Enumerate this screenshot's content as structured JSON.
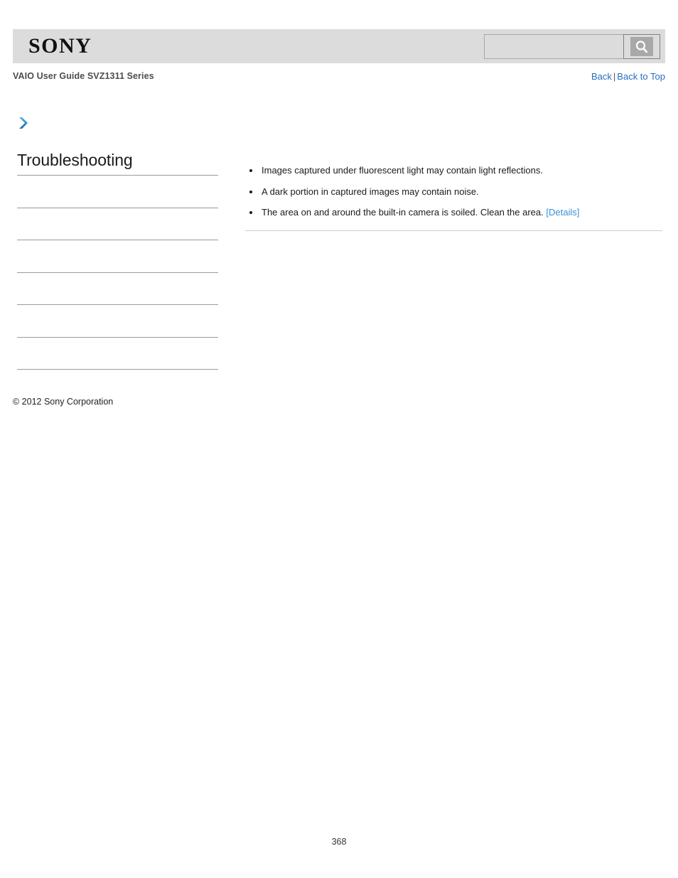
{
  "header": {
    "logo_text": "SONY",
    "search": {
      "value": "",
      "placeholder": "",
      "icon": "search-icon",
      "button_label": ""
    }
  },
  "subheader": {
    "guide_title": "VAIO User Guide SVZ1311 Series",
    "nav": {
      "back_label": "Back",
      "separator": "|",
      "back_to_top_label": "Back to Top"
    }
  },
  "breadcrumb_icon": "chevron-right-icon",
  "sidebar": {
    "title": "Troubleshooting",
    "items": [
      {
        "label": ""
      },
      {
        "label": ""
      },
      {
        "label": ""
      },
      {
        "label": ""
      },
      {
        "label": ""
      },
      {
        "label": ""
      }
    ]
  },
  "content": {
    "bullets": [
      {
        "text": "Images captured under fluorescent light may contain light reflections.",
        "link": ""
      },
      {
        "text": "A dark portion in captured images may contain noise.",
        "link": ""
      },
      {
        "text": "The area on and around the built-in camera is soiled. Clean the area.",
        "link": "[Details]"
      }
    ]
  },
  "footer": {
    "copyright": "© 2012 Sony Corporation",
    "page_number": "368"
  },
  "colors": {
    "header_bg": "#dcdcdc",
    "link_blue": "#2a6ebb",
    "detail_link_blue": "#3a8fd9",
    "arrow_blue": "#2e8bc8",
    "rule_gray": "#9a9a9a"
  }
}
